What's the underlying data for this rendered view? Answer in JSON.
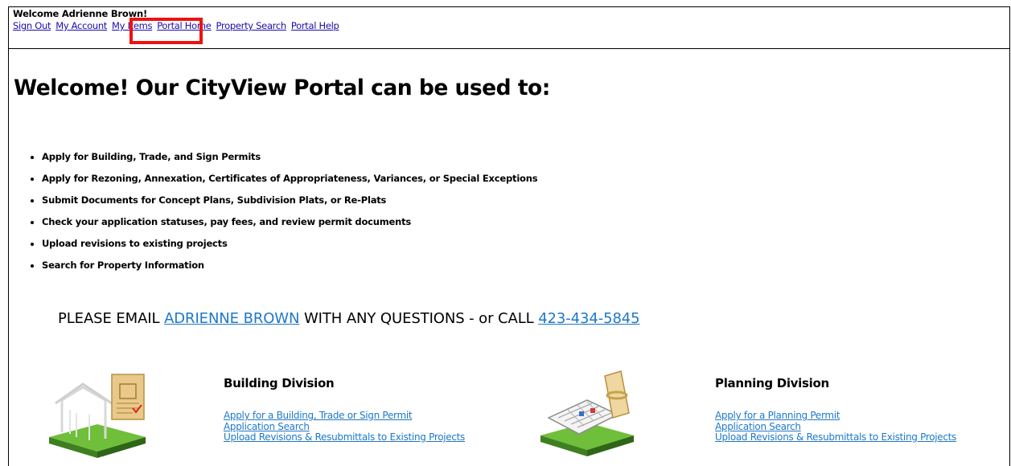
{
  "header": {
    "welcome": "Welcome Adrienne Brown!",
    "nav": [
      "Sign Out",
      "My Account",
      "My Items",
      "Portal Home",
      "Property Search",
      "Portal Help"
    ]
  },
  "main": {
    "headline": "Welcome! Our CityView Portal can be used to:",
    "bullets": [
      "Apply for Building, Trade, and Sign Permits",
      "Apply for Rezoning, Annexation, Certificates of Appropriateness, Variances, or Special Exceptions",
      "Submit Documents for Concept Plans, Subdivision Plats, or Re-Plats",
      "Check your application statuses, pay fees, and review permit documents",
      "Upload revisions to existing projects",
      "Search for Property Information"
    ],
    "contact": {
      "prefix": "PLEASE EMAIL ",
      "name_link": "ADRIENNE BROWN",
      "middle": " WITH ANY QUESTIONS - or CALL ",
      "phone_link": "423-434-5845"
    }
  },
  "divisions": {
    "building": {
      "title": "Building Division",
      "links": [
        "Apply for a Building, Trade or Sign Permit",
        "Application Search",
        "Upload Revisions & Resubmittals to Existing Projects"
      ]
    },
    "planning": {
      "title": "Planning Division",
      "links": [
        "Apply for a Planning Permit",
        "Application Search",
        "Upload Revisions & Resubmittals to Existing Projects"
      ]
    }
  },
  "colors": {
    "link": "#1f78c8",
    "nav_link": "#1a0dab",
    "highlight": "#e11111",
    "grass": "#5a9e2f"
  }
}
